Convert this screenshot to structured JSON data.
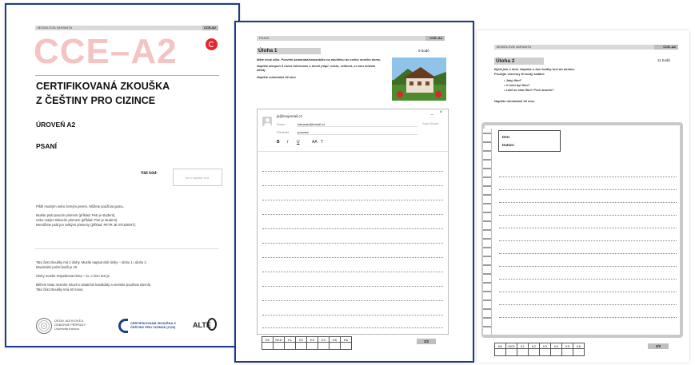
{
  "cover": {
    "header_left": "MODELOVÁ VARIANTA",
    "header_right": "CCE-A2",
    "big_code": "CCE–A2",
    "title_line1": "CERTIFIKOVANÁ ZKOUŠKA",
    "title_line2": "Z ČEŠTINY PRO CIZINCE",
    "level": "ÚROVEŇ A2",
    "section": "PSANÍ",
    "code_label": "Váš kód:",
    "code_placeholder": "Sem napište kód.",
    "instr": [
      "Piště modrým nebo černým perem. Můžete používat gumu.",
      "Musíte psát psacím písmem (příklad: Petr je student),",
      "nebo malým tiskacím písmem (příklad: Petr je student).",
      "Nemůžete psát jen velkými písmeny (příklad: PETR JE STUDENT)."
    ],
    "instr2": [
      "Tato část zkoušky má 2 úlohy. Musíte napsat obě úlohy – úlohu 1 i úlohu 2.",
      "Maximální počet bodů je 20.",
      "Úlohy musíte respektovat téma – to, o čem text je.",
      "Během testu nesmíte mluvit s ostatními kandidáty a nesmíte používat slovník.",
      "Tato část zkoušky trvá 40 minut."
    ],
    "logo1": "ÚSTAV JAZYKOVÉ A ODBORNÉ PŘÍPRAVY Univerzita Karlova",
    "logo2": "CERTIFIKOVANÁ ZKOUŠKA Z ČEŠTINY PRO CIZINCE (CCE)",
    "logo3": "ALTE"
  },
  "page2": {
    "header_left": "PSANÍ",
    "header_right": "CCE–A2",
    "task_title": "Úloha 1",
    "task_points": "9 bodů",
    "task_text": "Máte nový dům. Pozvěte kamaráda/kamarádku na návštěvu do svého nového domu.",
    "task_text2": "Napište alespoň 3 různé informace o domě (např. místo, velikost, co tam můžete dělat).",
    "task_text3": "Napište minimálně 40 slov.",
    "email_from": "ja@mujemail.cz",
    "email_to_label": "Komu",
    "email_to": "kamarad@email.cz",
    "email_copy": "Kopie Skrytá",
    "email_subject_label": "Předmět",
    "email_subject": "pozvání",
    "toolbar": [
      "B",
      "I",
      "U",
      "AA",
      "T"
    ],
    "win_controls": [
      "_",
      "×"
    ],
    "scores": [
      "KK",
      "KKD",
      "K1",
      "K2",
      "K3",
      "K4",
      "K5",
      "K6"
    ],
    "page_num": "1/2"
  },
  "page3": {
    "header_left": "MODELOVÁ VARIANTA",
    "header_right": "CCE–A2",
    "task_title": "Úloha 2",
    "task_points": "11 bodů",
    "task_text": "Byl/a jste v kině. Napište o tom krátký text do deníku.",
    "task_text2": "Použijte všechny tři body zadání:",
    "bullets": [
      "Jaký film?",
      "O čem byl film?",
      "Líbil se vám film? Proč ano/ne?"
    ],
    "task_text3": "Napište minimálně 60 slov.",
    "diary_day": "Den:",
    "diary_date": "Datum:",
    "scores": [
      "KK",
      "KKD",
      "K1",
      "K2",
      "K3",
      "K4",
      "K5",
      "K6"
    ],
    "page_num": "2/2"
  },
  "colors": {
    "frame_blue": "#1f3b8a",
    "big_code_pink": "#f4c3c3",
    "logo_red": "#e3262b"
  }
}
